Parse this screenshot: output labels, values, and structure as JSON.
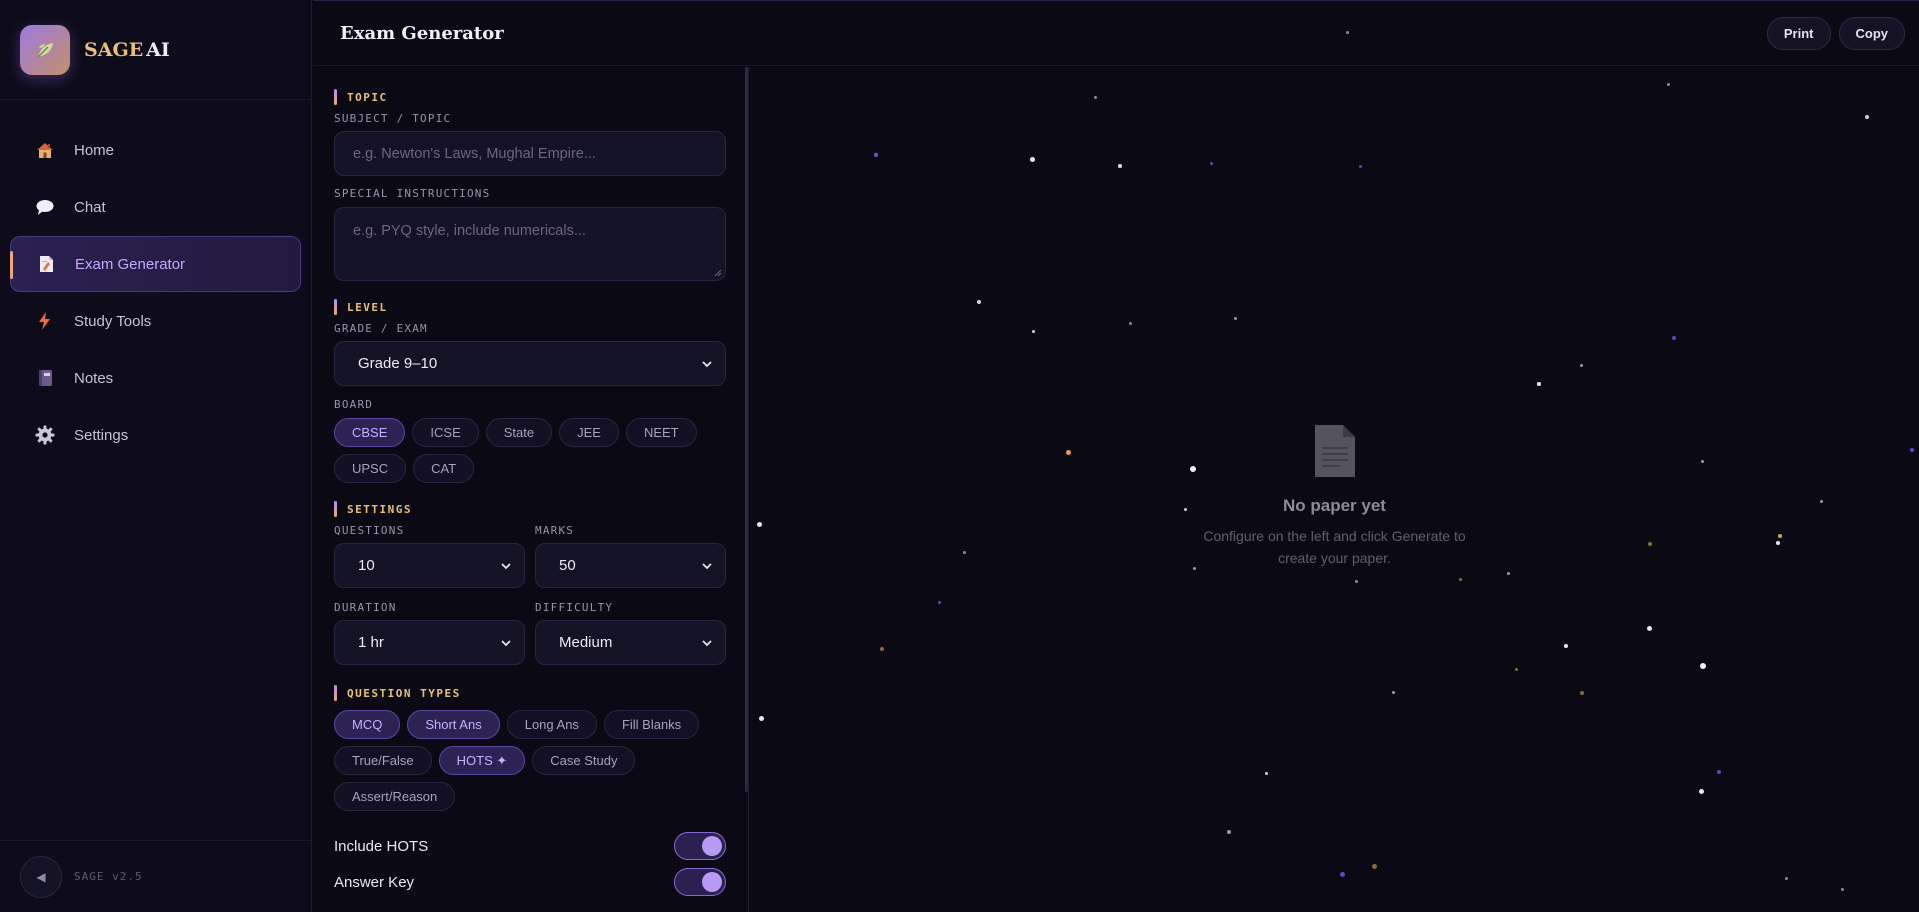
{
  "brand": {
    "name_part1": "SAGE",
    "name_part2": "AI"
  },
  "nav": [
    {
      "label": "Home",
      "icon": "house-icon",
      "active": false
    },
    {
      "label": "Chat",
      "icon": "speech-bubble-icon",
      "active": false
    },
    {
      "label": "Exam Generator",
      "icon": "document-icon",
      "active": true
    },
    {
      "label": "Study Tools",
      "icon": "lightning-icon",
      "active": false
    },
    {
      "label": "Notes",
      "icon": "notebook-icon",
      "active": false
    },
    {
      "label": "Settings",
      "icon": "gear-icon",
      "active": false
    }
  ],
  "sidebar_footer": {
    "collapse_glyph": "◀",
    "version": "SAGE v2.5"
  },
  "header": {
    "title": "Exam Generator",
    "print_label": "Print",
    "copy_label": "Copy"
  },
  "config": {
    "topic": {
      "section": "TOPIC",
      "subject_label": "SUBJECT / TOPIC",
      "subject_placeholder": "e.g. Newton's Laws, Mughal Empire...",
      "instructions_label": "SPECIAL INSTRUCTIONS",
      "instructions_placeholder": "e.g. PYQ style, include numericals..."
    },
    "level": {
      "section": "LEVEL",
      "grade_label": "GRADE / EXAM",
      "grade_value": "Grade 9–10",
      "board_label": "BOARD",
      "boards": [
        {
          "label": "CBSE",
          "selected": true
        },
        {
          "label": "ICSE",
          "selected": false
        },
        {
          "label": "State",
          "selected": false
        },
        {
          "label": "JEE",
          "selected": false
        },
        {
          "label": "NEET",
          "selected": false
        },
        {
          "label": "UPSC",
          "selected": false
        },
        {
          "label": "CAT",
          "selected": false
        }
      ]
    },
    "settings": {
      "section": "SETTINGS",
      "questions_label": "QUESTIONS",
      "questions_value": "10",
      "marks_label": "MARKS",
      "marks_value": "50",
      "duration_label": "DURATION",
      "duration_value": "1 hr",
      "difficulty_label": "DIFFICULTY",
      "difficulty_value": "Medium"
    },
    "question_types": {
      "section": "QUESTION TYPES",
      "types": [
        {
          "label": "MCQ",
          "selected": true
        },
        {
          "label": "Short Ans",
          "selected": true
        },
        {
          "label": "Long Ans",
          "selected": false
        },
        {
          "label": "Fill Blanks",
          "selected": false
        },
        {
          "label": "True/False",
          "selected": false
        },
        {
          "label": "HOTS ✦",
          "selected": true
        },
        {
          "label": "Case Study",
          "selected": false
        },
        {
          "label": "Assert/Reason",
          "selected": false
        }
      ]
    },
    "toggles": [
      {
        "label": "Include HOTS",
        "on": true
      },
      {
        "label": "Answer Key",
        "on": true
      }
    ]
  },
  "preview": {
    "empty_title": "No paper yet",
    "empty_message": "Configure on the left and click Generate to create your paper."
  },
  "colors": {
    "accent": "#b89af5",
    "gold": "#e8c07a",
    "background": "#0b0a14"
  }
}
